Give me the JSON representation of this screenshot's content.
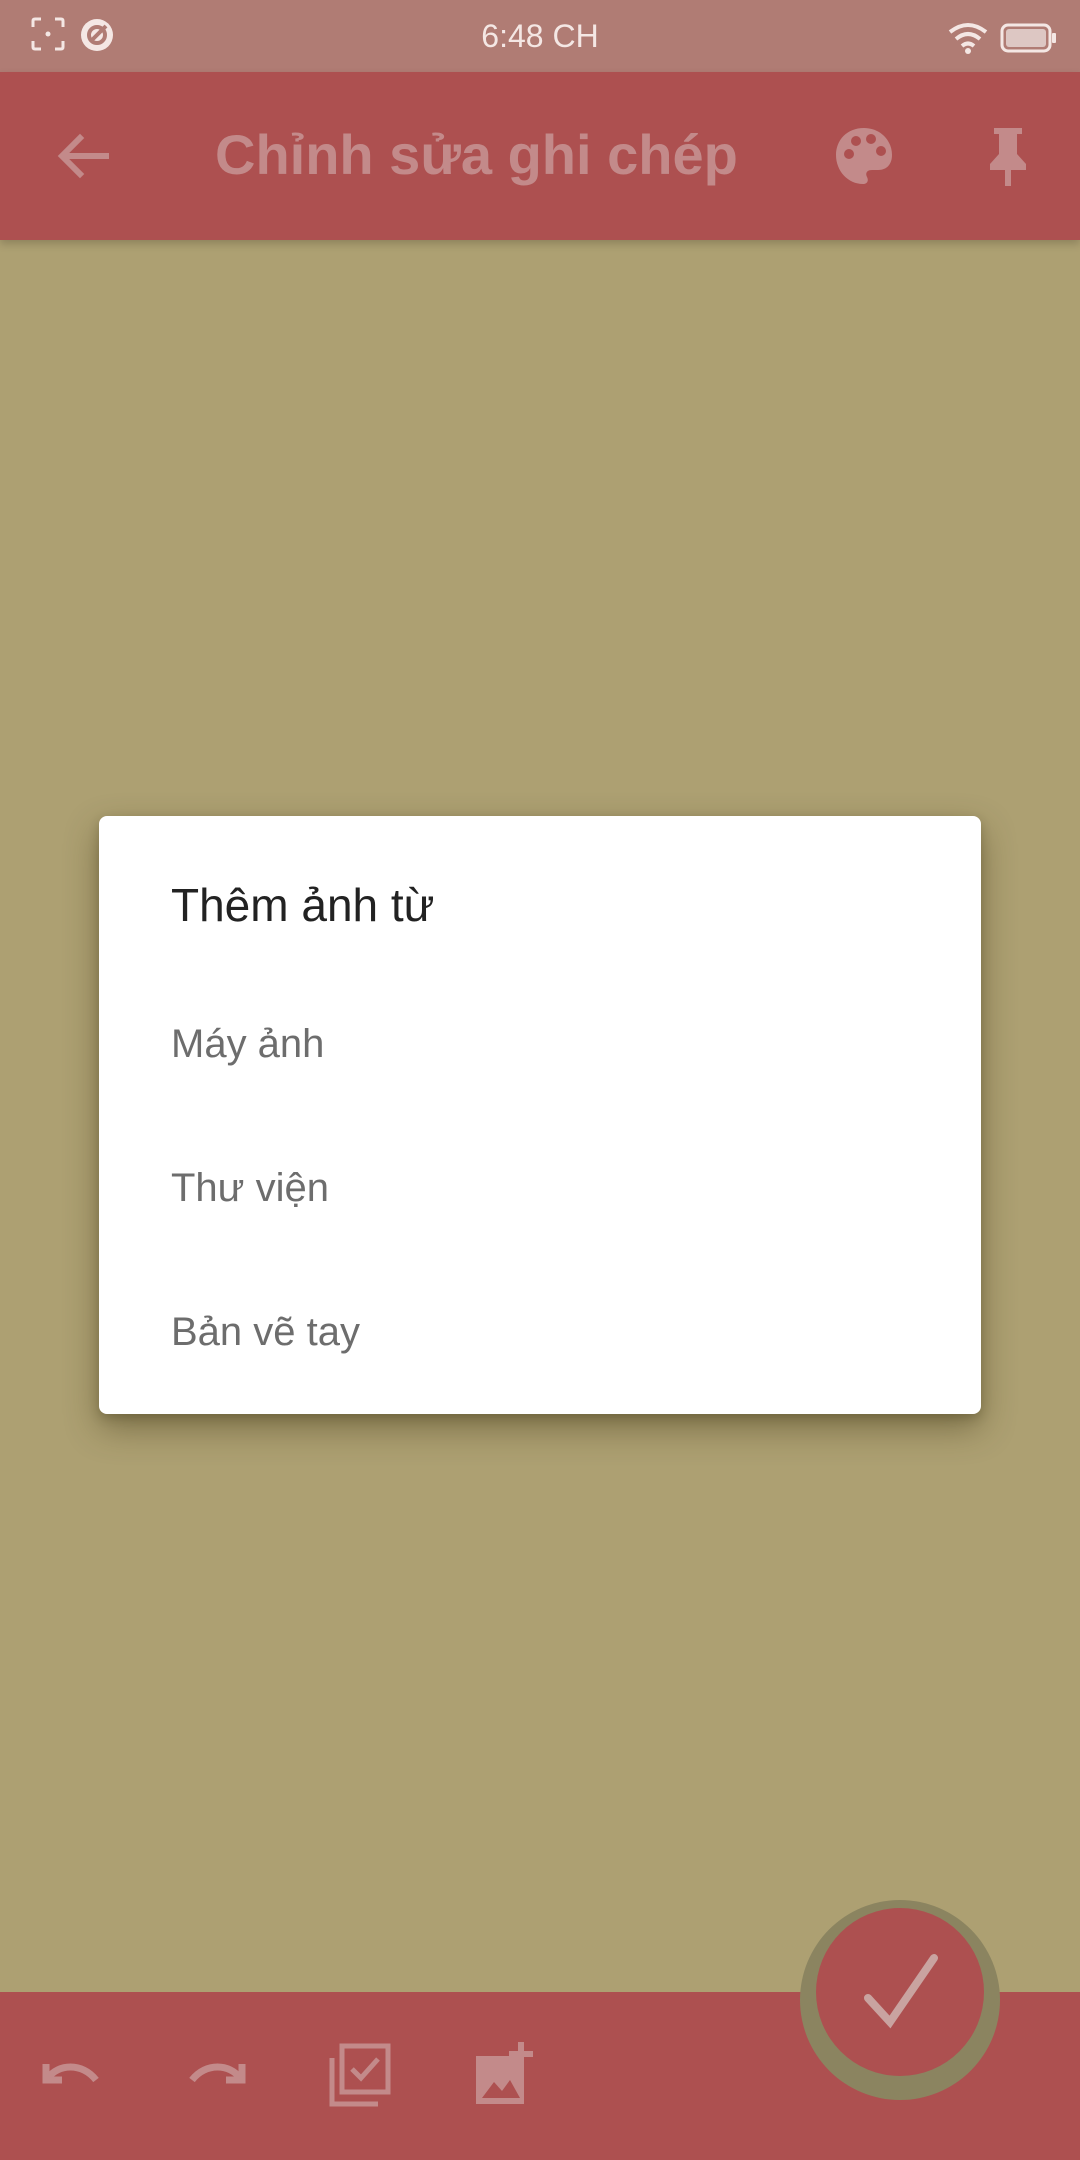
{
  "status_bar": {
    "time": "6:48 CH",
    "left_icons": [
      "screenshot-icon",
      "vpn-icon"
    ],
    "right_icons": [
      "wifi-icon",
      "battery-icon"
    ]
  },
  "app_bar": {
    "title": "Chỉnh sửa ghi chép",
    "back_icon": "arrow-back-icon",
    "actions": [
      "palette-icon",
      "pin-icon"
    ]
  },
  "dialog": {
    "title": "Thêm ảnh từ",
    "options": [
      {
        "label": "Máy ảnh"
      },
      {
        "label": "Thư viện"
      },
      {
        "label": "Bản vẽ tay"
      }
    ]
  },
  "bottom_bar": {
    "actions": [
      "undo-icon",
      "redo-icon",
      "checklist-icon",
      "add-image-icon"
    ]
  },
  "fab": {
    "icon": "check-icon"
  },
  "colors": {
    "primary": "#ad5050",
    "note_background": "#ada072",
    "dialog_background": "#ffffff",
    "dim_text": "#c38a8a"
  }
}
